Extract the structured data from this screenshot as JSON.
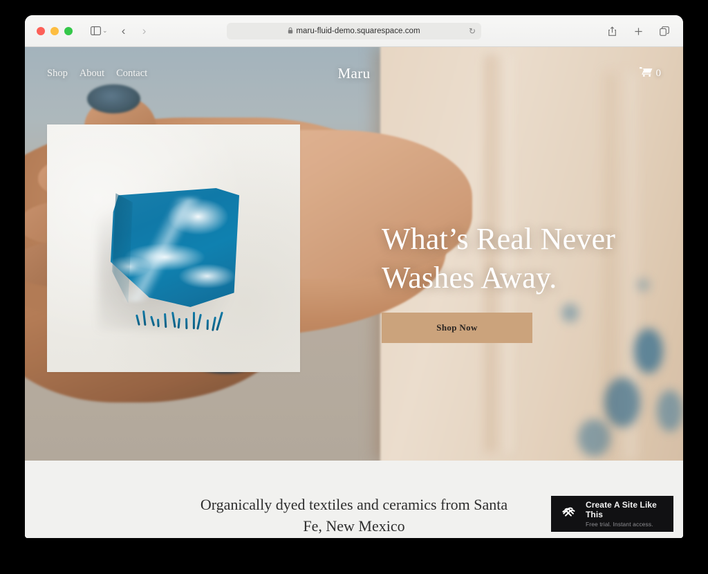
{
  "browser": {
    "url": "maru-fluid-demo.squarespace.com",
    "lock_icon": "lock-icon",
    "reload_icon": "reload-icon",
    "sidebar_icon": "sidebar-icon",
    "chevron_icon": "chevron-down-icon",
    "back_icon": "‹",
    "forward_icon": "›",
    "share_icon": "share-icon",
    "new_tab_icon": "plus-icon",
    "tabs_icon": "tab-overview-icon"
  },
  "site": {
    "logo": "Maru",
    "nav": [
      {
        "label": "Shop"
      },
      {
        "label": "About"
      },
      {
        "label": "Contact"
      }
    ],
    "cart": {
      "icon": "cart-icon",
      "count": "0"
    },
    "hero": {
      "headline_line1": "What’s Real Never",
      "headline_line2": "Washes Away.",
      "cta_label": "Shop Now",
      "cta_color": "#cba37c",
      "product_image_alt": "blue-tie-dyed-folded-textile"
    },
    "intro": {
      "line1": "Organically dyed textiles and ceramics from",
      "line2": "Santa Fe, New Mexico"
    }
  },
  "badge": {
    "logo_icon": "squarespace-logo-icon",
    "title": "Create A Site Like This",
    "subtitle": "Free trial. Instant access.",
    "background": "#111113"
  }
}
